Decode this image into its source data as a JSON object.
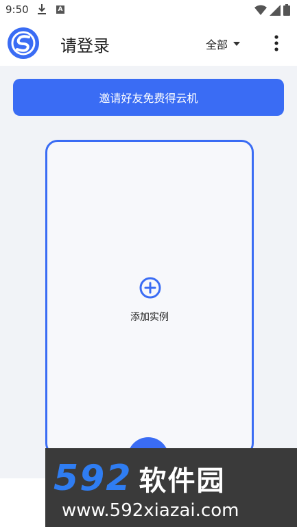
{
  "status_bar": {
    "time": "9:50"
  },
  "app_bar": {
    "title": "请登录",
    "filter_label": "全部"
  },
  "invite_button": {
    "label": "邀请好友免费得云机"
  },
  "instance_card": {
    "add_label": "添加实例"
  },
  "watermark": {
    "brand_number": "592",
    "brand_text": "软件园",
    "url": "www.592xiazai.com"
  },
  "colors": {
    "accent": "#3a6cf4",
    "watermark_bg": "#3a3a3a",
    "watermark_blue": "#2f7df2"
  }
}
